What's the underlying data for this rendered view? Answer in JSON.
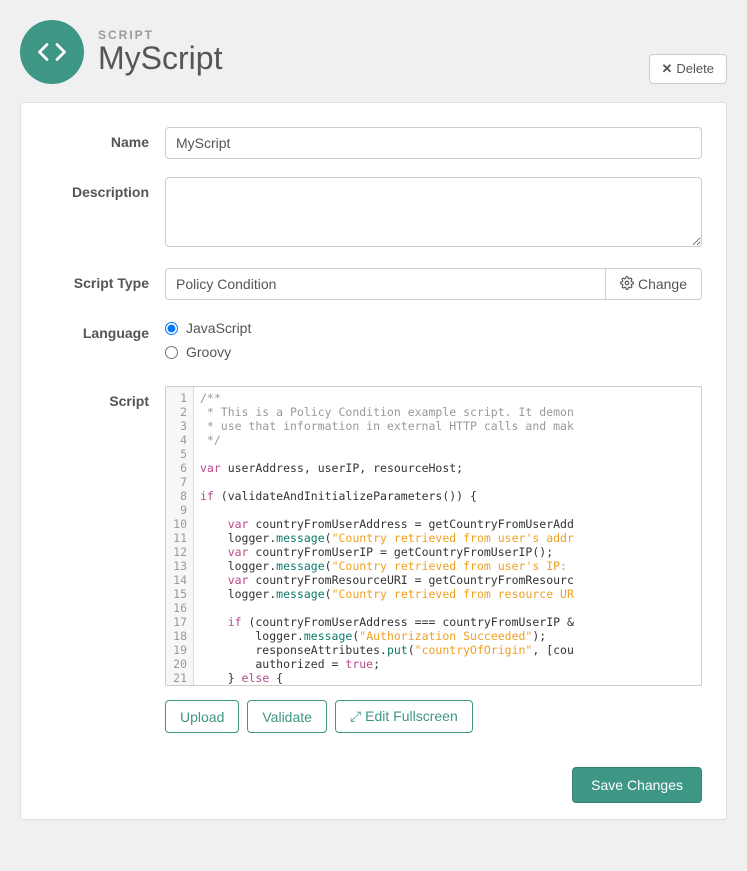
{
  "header": {
    "subheading": "SCRIPT",
    "title": "MyScript",
    "delete_label": "Delete"
  },
  "form": {
    "name_label": "Name",
    "name_value": "MyScript",
    "description_label": "Description",
    "description_value": "",
    "script_type_label": "Script Type",
    "script_type_value": "Policy Condition",
    "change_label": "Change",
    "language_label": "Language",
    "language_options": [
      "JavaScript",
      "Groovy"
    ],
    "language_selected": "JavaScript",
    "script_label": "Script"
  },
  "code": {
    "line_start": 1,
    "line_end": 21,
    "lines": [
      {
        "n": 1,
        "t": [
          {
            "c": "comment",
            "s": "/**"
          }
        ]
      },
      {
        "n": 2,
        "t": [
          {
            "c": "comment",
            "s": " * This is a Policy Condition example script. It demon"
          }
        ]
      },
      {
        "n": 3,
        "t": [
          {
            "c": "comment",
            "s": " * use that information in external HTTP calls and mak"
          }
        ]
      },
      {
        "n": 4,
        "t": [
          {
            "c": "comment",
            "s": " */"
          }
        ]
      },
      {
        "n": 5,
        "t": []
      },
      {
        "n": 6,
        "t": [
          {
            "c": "keyword",
            "s": "var"
          },
          {
            "c": "text",
            "s": " userAddress, userIP, resourceHost;"
          }
        ]
      },
      {
        "n": 7,
        "t": []
      },
      {
        "n": 8,
        "t": [
          {
            "c": "keyword",
            "s": "if"
          },
          {
            "c": "text",
            "s": " (validateAndInitializeParameters()) {"
          }
        ]
      },
      {
        "n": 9,
        "t": []
      },
      {
        "n": 10,
        "t": [
          {
            "c": "text",
            "s": "    "
          },
          {
            "c": "keyword",
            "s": "var"
          },
          {
            "c": "text",
            "s": " countryFromUserAddress = getCountryFromUserAdd"
          }
        ]
      },
      {
        "n": 11,
        "t": [
          {
            "c": "text",
            "s": "    logger."
          },
          {
            "c": "prop",
            "s": "message"
          },
          {
            "c": "text",
            "s": "("
          },
          {
            "c": "string",
            "s": "\"Country retrieved from user's addr"
          }
        ]
      },
      {
        "n": 12,
        "t": [
          {
            "c": "text",
            "s": "    "
          },
          {
            "c": "keyword",
            "s": "var"
          },
          {
            "c": "text",
            "s": " countryFromUserIP = getCountryFromUserIP();"
          }
        ]
      },
      {
        "n": 13,
        "t": [
          {
            "c": "text",
            "s": "    logger."
          },
          {
            "c": "prop",
            "s": "message"
          },
          {
            "c": "text",
            "s": "("
          },
          {
            "c": "string",
            "s": "\"Country retrieved from user's IP: "
          }
        ]
      },
      {
        "n": 14,
        "t": [
          {
            "c": "text",
            "s": "    "
          },
          {
            "c": "keyword",
            "s": "var"
          },
          {
            "c": "text",
            "s": " countryFromResourceURI = getCountryFromResourc"
          }
        ]
      },
      {
        "n": 15,
        "t": [
          {
            "c": "text",
            "s": "    logger."
          },
          {
            "c": "prop",
            "s": "message"
          },
          {
            "c": "text",
            "s": "("
          },
          {
            "c": "string",
            "s": "\"Country retrieved from resource UR"
          }
        ]
      },
      {
        "n": 16,
        "t": []
      },
      {
        "n": 17,
        "t": [
          {
            "c": "text",
            "s": "    "
          },
          {
            "c": "keyword",
            "s": "if"
          },
          {
            "c": "text",
            "s": " (countryFromUserAddress === countryFromUserIP &"
          }
        ]
      },
      {
        "n": 18,
        "t": [
          {
            "c": "text",
            "s": "        logger."
          },
          {
            "c": "prop",
            "s": "message"
          },
          {
            "c": "text",
            "s": "("
          },
          {
            "c": "string",
            "s": "\"Authorization Succeeded\""
          },
          {
            "c": "text",
            "s": ");"
          }
        ]
      },
      {
        "n": 19,
        "t": [
          {
            "c": "text",
            "s": "        responseAttributes."
          },
          {
            "c": "prop",
            "s": "put"
          },
          {
            "c": "text",
            "s": "("
          },
          {
            "c": "string",
            "s": "\"countryOfOrigin\""
          },
          {
            "c": "text",
            "s": ", [cou"
          }
        ]
      },
      {
        "n": 20,
        "t": [
          {
            "c": "text",
            "s": "        authorized = "
          },
          {
            "c": "keyword",
            "s": "true"
          },
          {
            "c": "text",
            "s": ";"
          }
        ]
      },
      {
        "n": 21,
        "t": [
          {
            "c": "text",
            "s": "    } "
          },
          {
            "c": "keyword",
            "s": "else"
          },
          {
            "c": "text",
            "s": " {"
          }
        ]
      }
    ]
  },
  "buttons": {
    "upload": "Upload",
    "validate": "Validate",
    "fullscreen": "Edit Fullscreen",
    "save": "Save Changes"
  }
}
